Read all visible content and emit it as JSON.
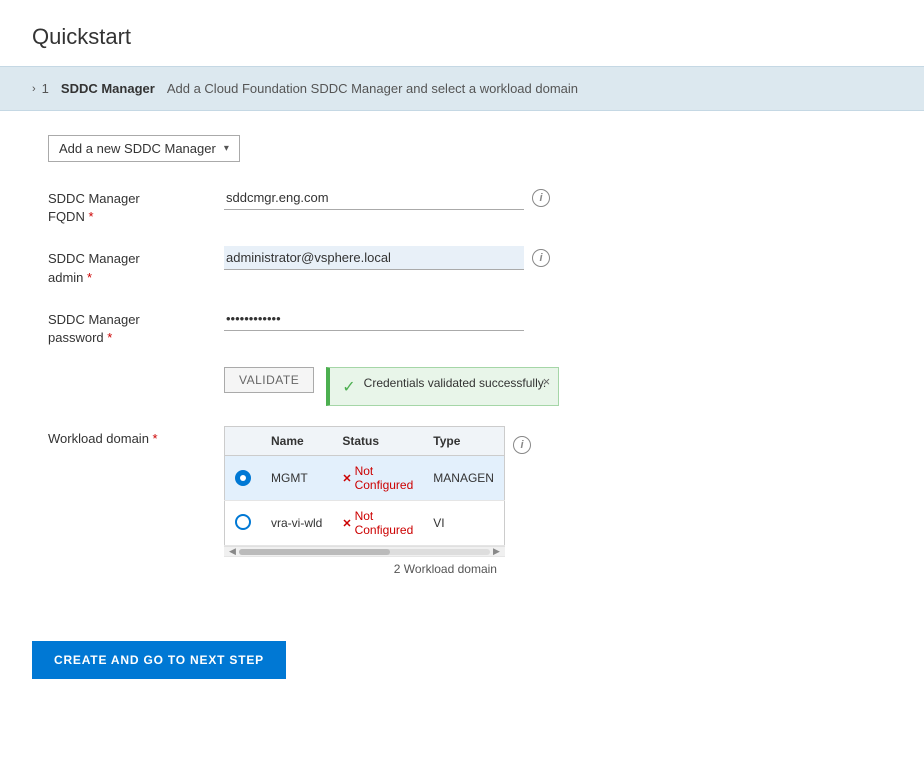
{
  "page": {
    "title": "Quickstart"
  },
  "step_header": {
    "chevron": "›",
    "number": "1",
    "label": "SDDC Manager",
    "separator": "",
    "description": "Add a Cloud Foundation SDDC Manager and select a workload domain"
  },
  "dropdown": {
    "label": "Add a new SDDC Manager"
  },
  "form": {
    "fqdn_label": "SDDC Manager",
    "fqdn_label2": "FQDN",
    "fqdn_required": "*",
    "fqdn_value": "sddcmgr.eng.com",
    "fqdn_placeholder": "",
    "admin_label": "SDDC Manager",
    "admin_label2": "admin",
    "admin_required": "*",
    "admin_value": "administrator@vsphere.local",
    "password_label": "SDDC Manager",
    "password_label2": "password",
    "password_required": "*",
    "password_value": "••••••••••"
  },
  "validate_btn": {
    "label": "VALIDATE"
  },
  "toast": {
    "message": "Credentials validated successfully.",
    "close": "×"
  },
  "workload": {
    "label": "Workload domain",
    "required": "*",
    "table": {
      "columns": [
        "Name",
        "Status",
        "Type"
      ],
      "rows": [
        {
          "selected": true,
          "name": "MGMT",
          "status": "Not Configured",
          "type": "MANAGEN"
        },
        {
          "selected": false,
          "name": "vra-vi-wld",
          "status": "Not Configured",
          "type": "VI"
        }
      ],
      "count": "2 Workload domain"
    }
  },
  "action_btn": {
    "label": "CREATE AND GO TO NEXT STEP"
  }
}
